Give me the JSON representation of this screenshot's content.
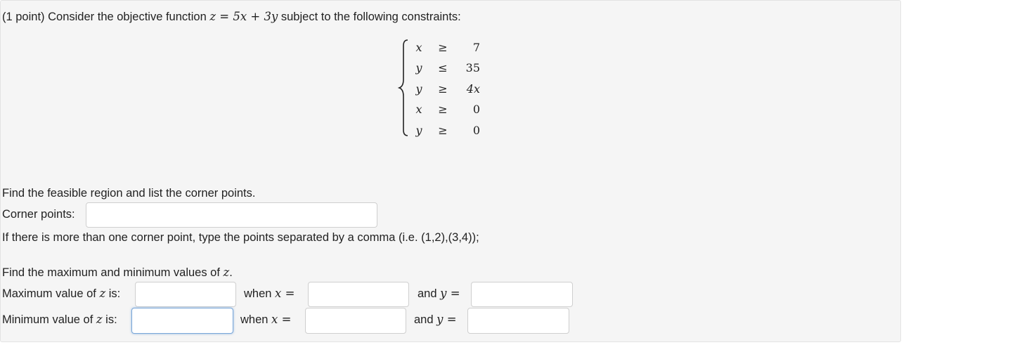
{
  "problem": {
    "intro_prefix": "(1 point) Consider the objective function ",
    "objective": "z = 5x + 3y",
    "intro_suffix": " subject to the following constraints:"
  },
  "constraints": [
    {
      "lhs": "x",
      "op": "≥",
      "rhs": "7"
    },
    {
      "lhs": "y",
      "op": "≤",
      "rhs": "35"
    },
    {
      "lhs": "y",
      "op": "≥",
      "rhs": "4x"
    },
    {
      "lhs": "x",
      "op": "≥",
      "rhs": "0"
    },
    {
      "lhs": "y",
      "op": "≥",
      "rhs": "0"
    }
  ],
  "part1": {
    "instruction": "Find the feasible region and list the corner points.",
    "corner_label": "Corner points:",
    "corner_value": "",
    "hint": "If there is more than one corner point, type the points separated by a comma (i.e. (1,2),(3,4));"
  },
  "part2": {
    "instruction_prefix": "Find the maximum and minimum values of ",
    "instruction_var": "z",
    "instruction_suffix": ".",
    "max_label_prefix": "Maximum value of ",
    "min_label_prefix": "Minimum value of ",
    "label_var": "z",
    "label_suffix": " is:",
    "when_text": "when ",
    "x_eq": "x =",
    "and_text": "and ",
    "y_eq": "y ="
  },
  "answers": {
    "max_value": "",
    "max_x": "",
    "max_y": "",
    "min_value": "",
    "min_x": "",
    "min_y": ""
  }
}
